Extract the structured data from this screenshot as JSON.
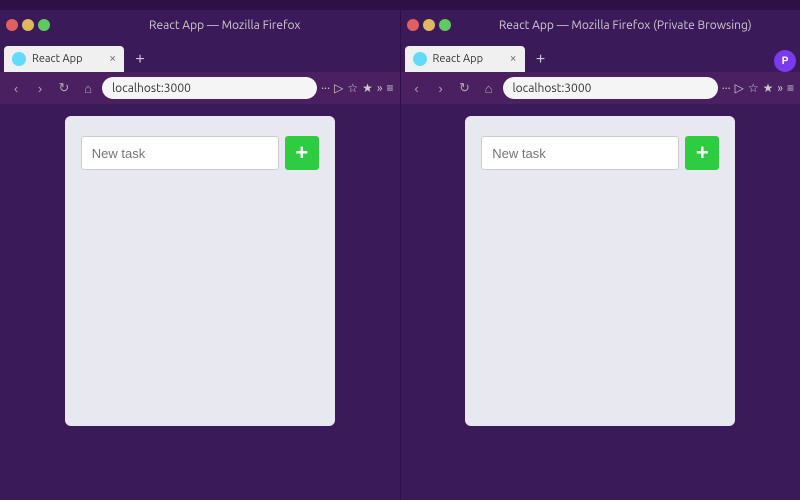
{
  "browsers": [
    {
      "id": "browser-left",
      "titlebar_title": "React App — Mozilla Firefox",
      "tab_label": "React App",
      "url": "localhost:3000",
      "is_private": false,
      "app": {
        "input_placeholder": "New task",
        "add_button_label": "+"
      }
    },
    {
      "id": "browser-right",
      "titlebar_title": "React App — Mozilla Firefox (Private Browsing)",
      "tab_label": "React App",
      "url": "localhost:3000",
      "is_private": true,
      "app": {
        "input_placeholder": "New task",
        "add_button_label": "+"
      }
    }
  ],
  "nav": {
    "back": "‹",
    "forward": "›",
    "reload": "↻",
    "home": "⌂",
    "more": "···",
    "bookmark": "☆",
    "star": "★",
    "overflow": "»",
    "menu": "≡"
  }
}
